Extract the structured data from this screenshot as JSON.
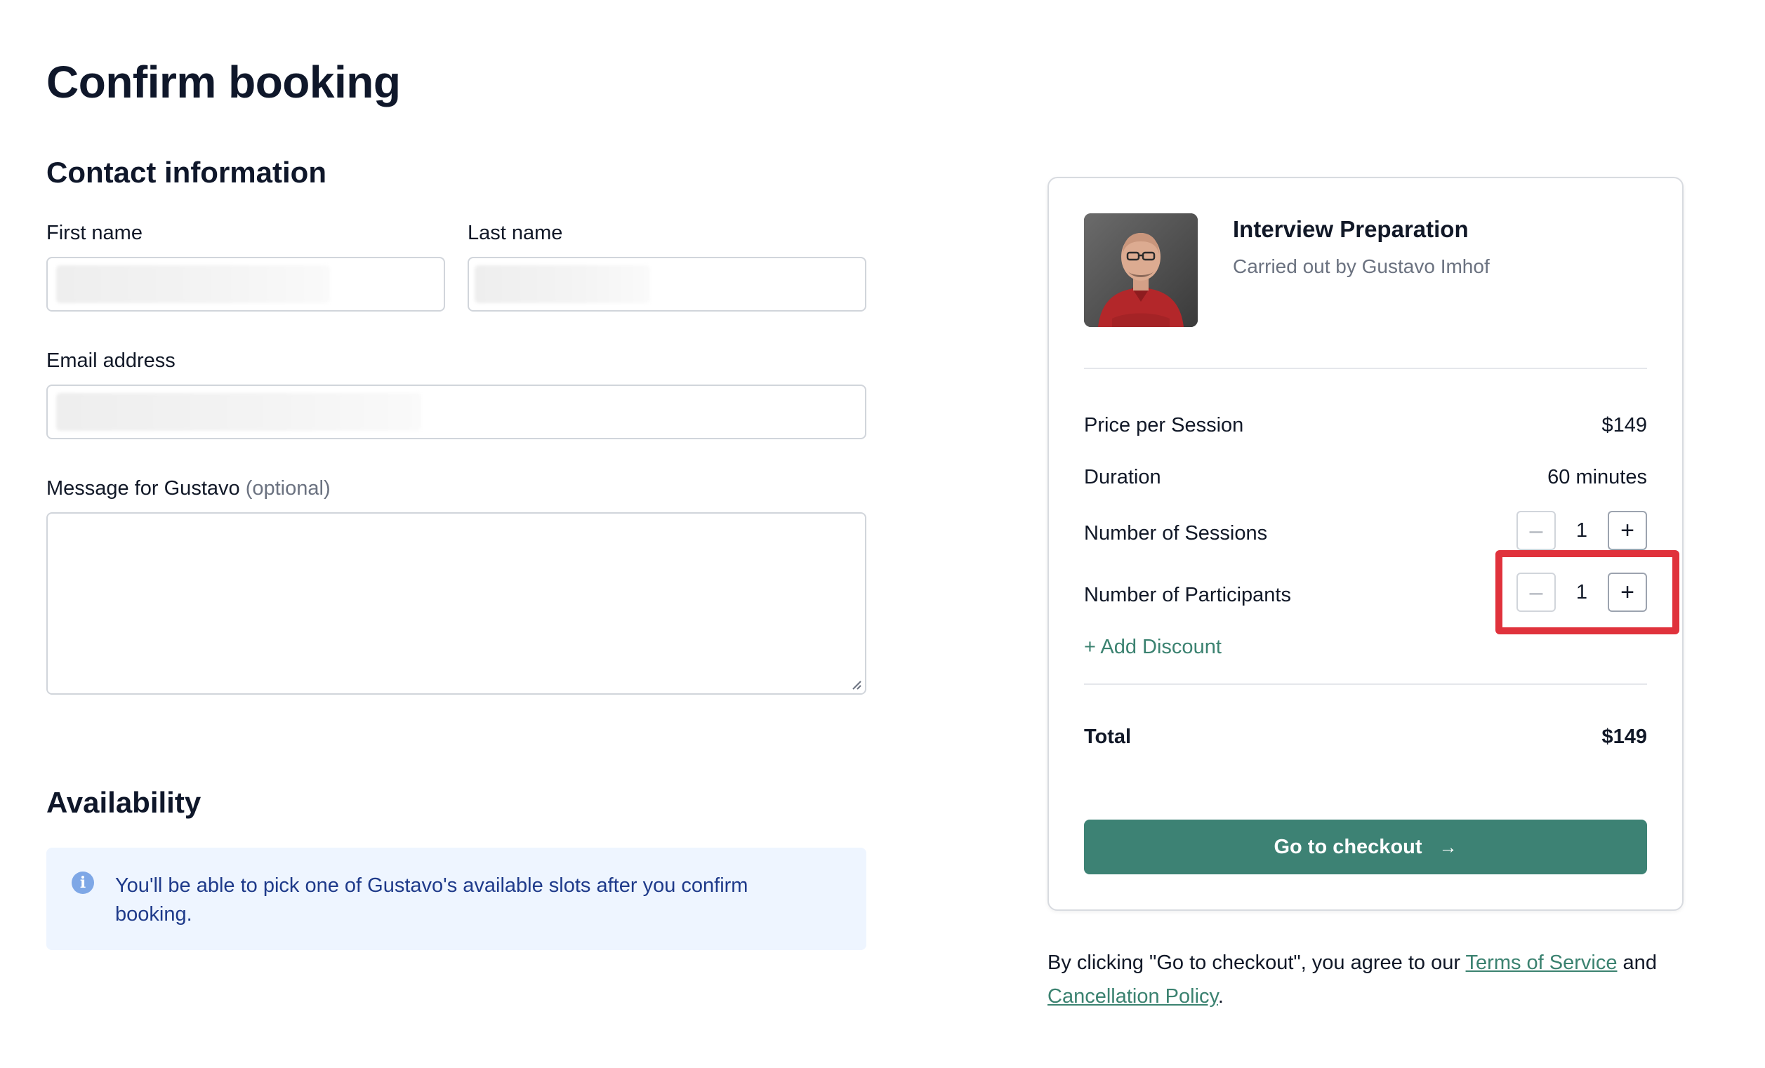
{
  "page": {
    "title": "Confirm booking"
  },
  "contact": {
    "section_title": "Contact information",
    "first_name_label": "First name",
    "last_name_label": "Last name",
    "email_label": "Email address",
    "message_label": "Message for Gustavo",
    "message_optional": "(optional)"
  },
  "availability": {
    "section_title": "Availability",
    "info_text": "You'll be able to pick one of Gustavo's available slots after you confirm booking."
  },
  "summary": {
    "service_title": "Interview Preparation",
    "service_subtitle": "Carried out by Gustavo Imhof",
    "price_label": "Price per Session",
    "price_value": "$149",
    "duration_label": "Duration",
    "duration_value": "60 minutes",
    "sessions_label": "Number of Sessions",
    "sessions_value": "1",
    "participants_label": "Number of Participants",
    "participants_value": "1",
    "discount_link": "+ Add Discount",
    "total_label": "Total",
    "total_value": "$149",
    "checkout_label": "Go to checkout",
    "minus_symbol": "–",
    "plus_symbol": "+",
    "arrow_symbol": "→"
  },
  "terms": {
    "prefix": "By clicking \"Go to checkout\", you agree to our ",
    "tos_link": "Terms of Service",
    "middle": " and ",
    "cancellation_link": "Cancellation Policy",
    "suffix": "."
  },
  "colors": {
    "accent": "#3d8274",
    "link": "#3b8270",
    "info_bg": "#eef5ff",
    "info_text": "#1e3a8a",
    "highlight": "#e0323c"
  },
  "icons": {
    "info": "info-icon",
    "arrow": "arrow-right-icon",
    "minus": "minus-icon",
    "plus": "plus-icon"
  }
}
